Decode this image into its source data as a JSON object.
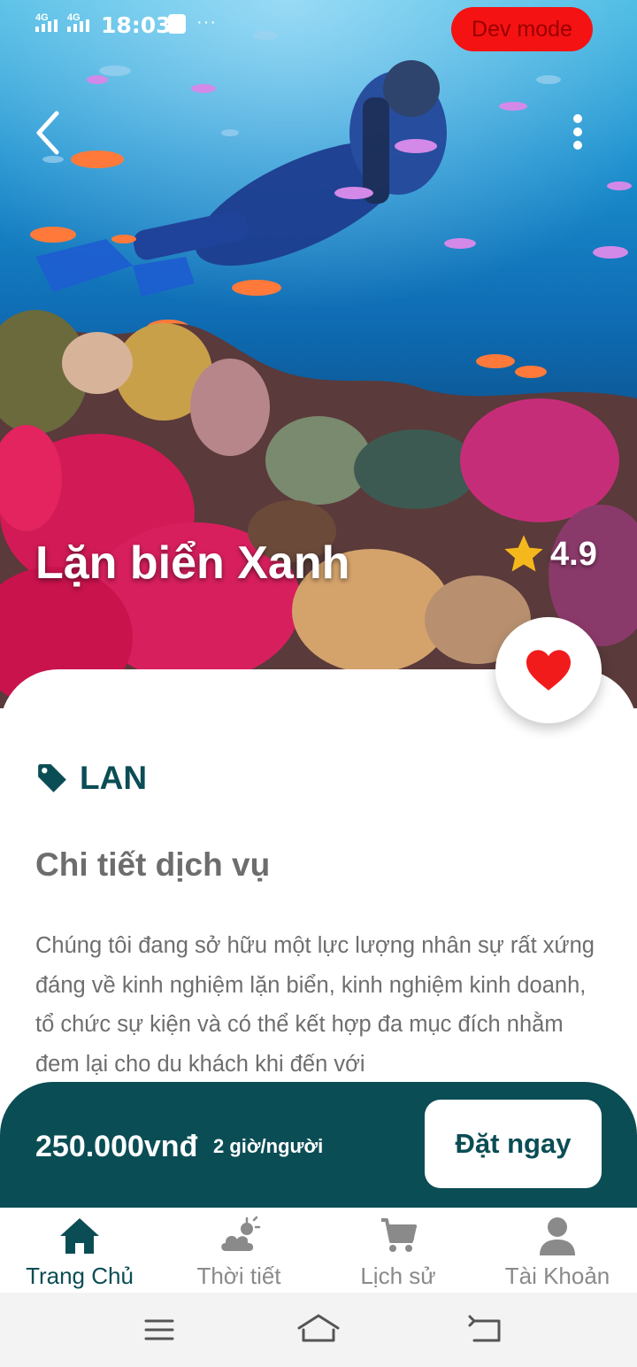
{
  "status_bar": {
    "network_1": "4G",
    "network_2": "4G",
    "time": "18:03",
    "dev_mode": "Dev mode"
  },
  "header": {
    "back_icon": "chevron-left-icon",
    "more_icon": "more-vertical-icon"
  },
  "hero": {
    "image_subject": "underwater-scuba-diver-coral-reef",
    "title": "Lặn biển Xanh",
    "rating": "4.9",
    "rating_icon": "star-icon"
  },
  "favorite": {
    "icon": "heart-icon",
    "color": "#f21b1b"
  },
  "detail": {
    "tag_icon": "tag-icon",
    "tag": "LAN",
    "section_title": "Chi tiết dịch vụ",
    "description": " Chúng tôi đang sở hữu một lực lượng nhân sự rất xứng đáng về kinh nghiệm lặn biển, kinh nghiệm kinh doanh, tổ chức sự kiện và có thể kết hợp đa mục đích nhằm đem lại cho du khách khi đến với"
  },
  "booking": {
    "price": "250.000vnđ",
    "duration": "2 giờ/người",
    "book_label": "Đặt ngay"
  },
  "bottom_nav": [
    {
      "label": "Trang Chủ",
      "icon": "home-icon",
      "active": true
    },
    {
      "label": "Thời tiết",
      "icon": "weather-icon",
      "active": false
    },
    {
      "label": "Lịch sử",
      "icon": "cart-icon",
      "active": false
    },
    {
      "label": "Tài Khoản",
      "icon": "user-icon",
      "active": false
    }
  ],
  "system_nav": {
    "menu_icon": "menu-icon",
    "home_icon": "home-outline-icon",
    "back_icon": "back-arrow-icon"
  },
  "colors": {
    "primary": "#0b4d55",
    "dev_mode_bg": "#f41212",
    "star": "#f5b81c",
    "heart": "#f21b1b"
  }
}
